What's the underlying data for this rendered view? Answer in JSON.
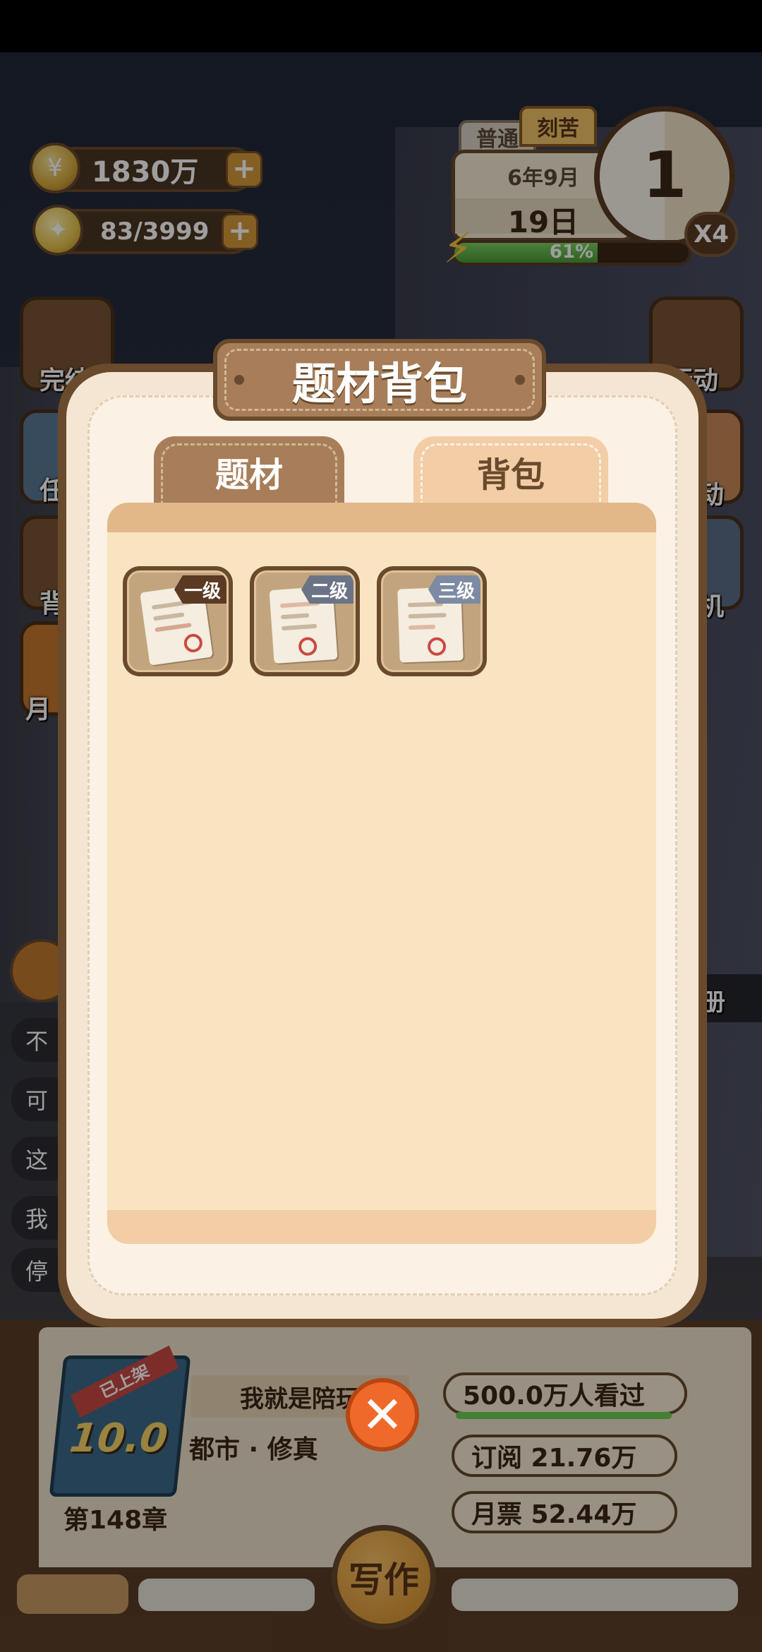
{
  "resources": {
    "coins": "1830万",
    "inspiration": "83/3999"
  },
  "calendar": {
    "mode_normal": "普通",
    "mode_hard": "刻苦",
    "year_month": "6年9月",
    "day": "19日",
    "clock_value": "1",
    "energy_percent_label": "61%",
    "energy_percent": 61,
    "speed": "X4"
  },
  "side_buttons": {
    "left_1": "完结",
    "left_2": "任",
    "left_3": "背",
    "left_4": "月",
    "right_1": "行动",
    "right_2": "动",
    "right_3": "机",
    "right_4": "万册"
  },
  "chat": [
    "不",
    "可",
    "这",
    "我",
    "停"
  ],
  "modal": {
    "title": "题材背包",
    "tabs": [
      {
        "label": "题材",
        "active": false
      },
      {
        "label": "背包",
        "active": true
      }
    ],
    "items": [
      {
        "badge": "一级",
        "badge_color": "#5a3a22"
      },
      {
        "badge": "二级",
        "badge_color": "#6b7486"
      },
      {
        "badge": "三级",
        "badge_color": "#7c8aa2"
      }
    ]
  },
  "book": {
    "ribbon": "已上架",
    "score": "10.0",
    "chapter": "第148章",
    "title": "我就是陪玩",
    "genre": "都市 · 修真",
    "readers": "500.0万人看过",
    "subscriptions": "订阅  21.76万",
    "monthly_votes": "月票  52.44万"
  },
  "write_button": "写作"
}
